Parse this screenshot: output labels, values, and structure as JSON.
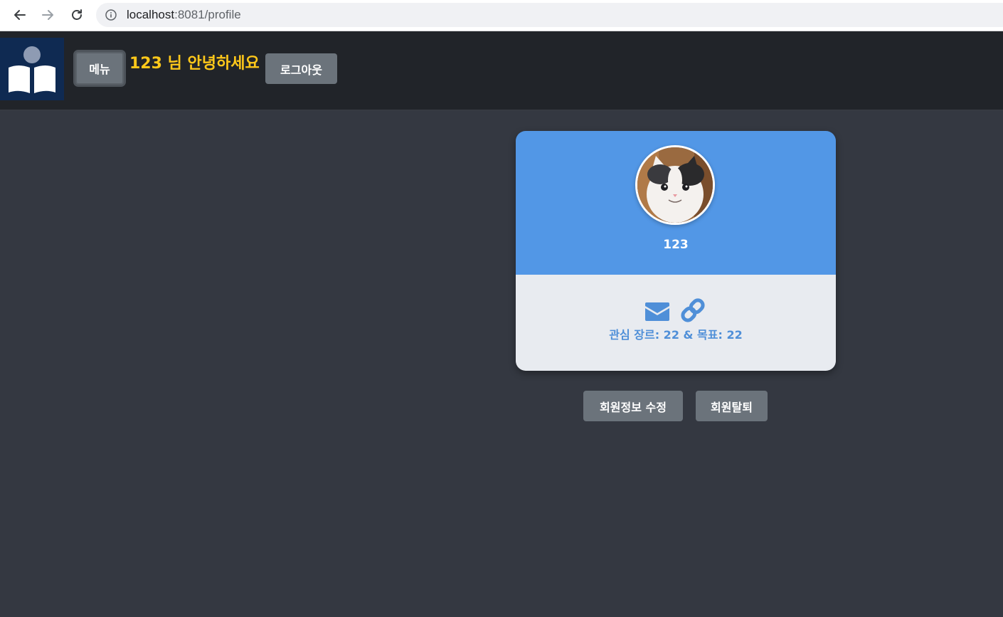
{
  "browser": {
    "url_host": "localhost",
    "url_rest": ":8081/profile"
  },
  "header": {
    "menu_label": "메뉴",
    "greeting": "123 님 안녕하세요",
    "logout_label": "로그아웃"
  },
  "profile": {
    "username": "123",
    "interest_text": "관심 장르: 22 & 목표: 22"
  },
  "actions": {
    "edit_label": "회원정보 수정",
    "withdraw_label": "회원탈퇴"
  },
  "colors": {
    "card_top": "#5297e6",
    "card_bottom": "#e8ebf0",
    "greeting": "#ffc81a",
    "button": "#6b737b",
    "header": "#212429",
    "background": "#343841"
  },
  "icons": {
    "logo": "open-book-reader-icon",
    "mail": "envelope-icon",
    "link": "chain-link-icon"
  }
}
